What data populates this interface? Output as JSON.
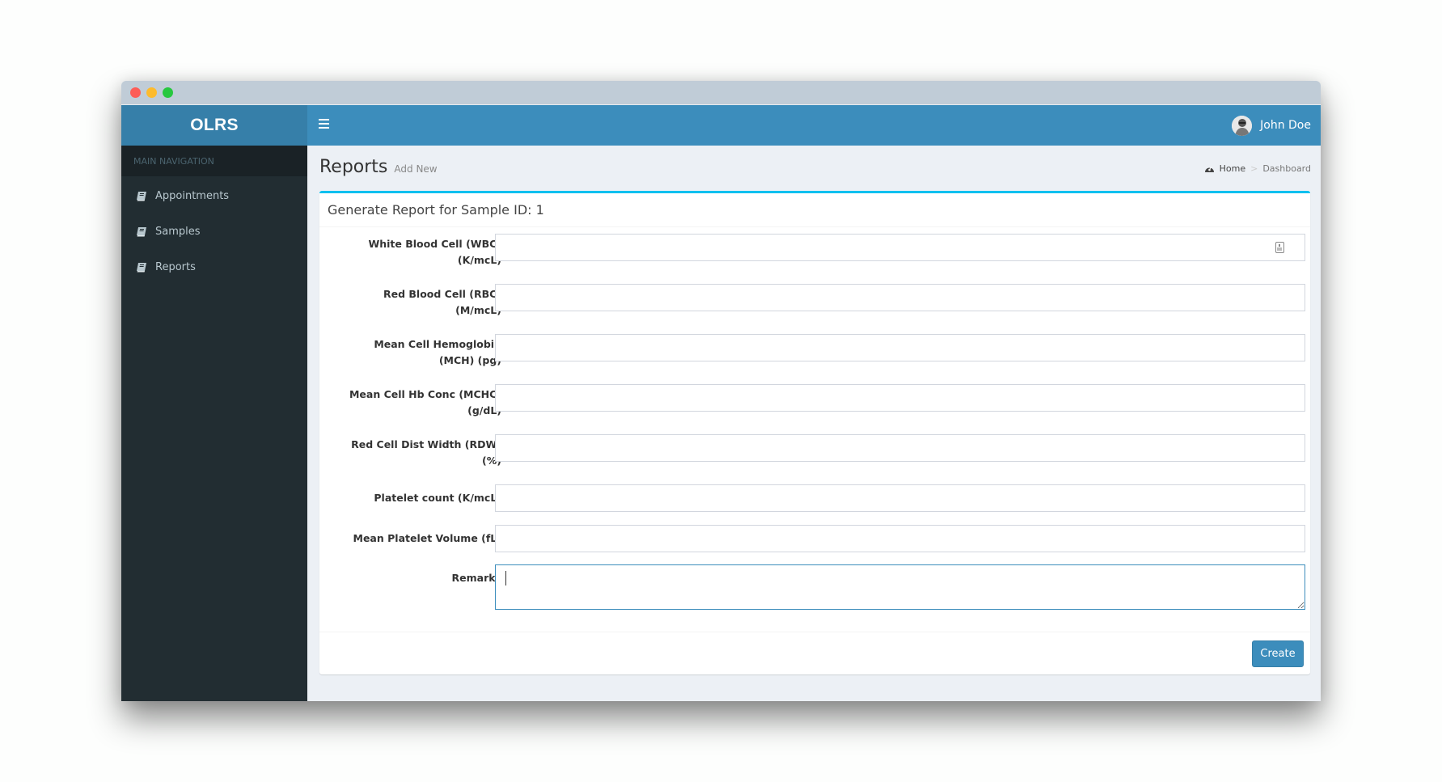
{
  "app": {
    "logo": "OLRS",
    "user_name": "John Doe"
  },
  "sidebar": {
    "header": "MAIN NAVIGATION",
    "items": [
      {
        "label": "Appointments",
        "icon": "book-icon"
      },
      {
        "label": "Samples",
        "icon": "book-icon"
      },
      {
        "label": "Reports",
        "icon": "book-icon"
      }
    ]
  },
  "page": {
    "title": "Reports",
    "subtitle": "Add New",
    "breadcrumb": [
      {
        "label": "Home",
        "icon": "dashboard-icon"
      },
      {
        "label": "Dashboard"
      }
    ]
  },
  "form": {
    "title": "Generate Report for Sample ID: 1",
    "fields": [
      {
        "label_line1": "White Blood Cell (WBC)",
        "label_line2": "(K/mcL)",
        "value": "",
        "placeholder": ""
      },
      {
        "label_line1": "Red Blood Cell (RBC)",
        "label_line2": "(M/mcL)",
        "value": "",
        "placeholder": ""
      },
      {
        "label_line1": "Mean Cell Hemoglobin",
        "label_line2": "(MCH) (pg)",
        "value": "",
        "placeholder": ""
      },
      {
        "label_line1": "Mean Cell Hb Conc (MCHC)",
        "label_line2": "(g/dL)",
        "value": "",
        "placeholder": ""
      },
      {
        "label_line1": "Red Cell Dist Width (RDW)",
        "label_line2": "(%)",
        "value": "",
        "placeholder": ""
      },
      {
        "label_line1": "Platelet count (K/mcL)",
        "label_line2": "",
        "value": "",
        "placeholder": ""
      },
      {
        "label_line1": "Mean Platelet Volume (fL)",
        "label_line2": "",
        "value": "",
        "placeholder": ""
      }
    ],
    "remarks": {
      "label": "Remarks",
      "value": ""
    },
    "submit_label": "Create"
  },
  "colors": {
    "navbar": "#3c8dbc",
    "logo_bg": "#367fa9",
    "sidebar": "#222d32",
    "box_accent": "#00c0ef"
  }
}
